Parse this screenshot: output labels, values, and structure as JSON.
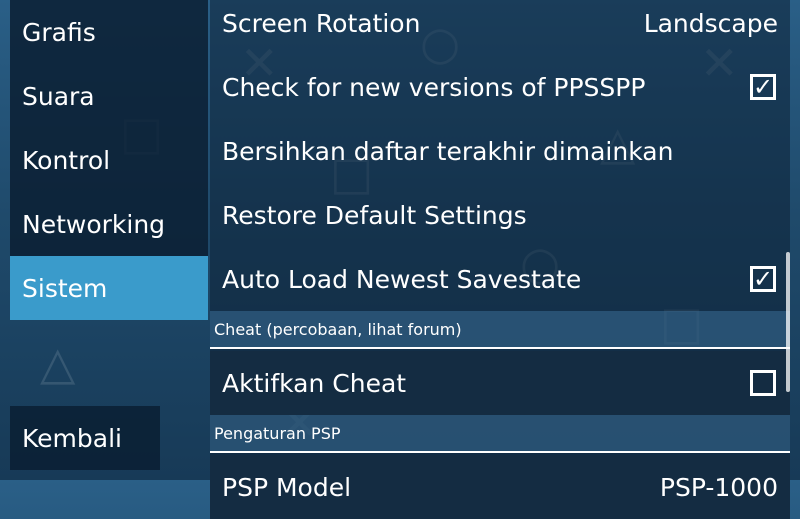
{
  "sidebar": {
    "tabs": [
      {
        "label": "Grafis"
      },
      {
        "label": "Suara"
      },
      {
        "label": "Kontrol"
      },
      {
        "label": "Networking"
      },
      {
        "label": "Sistem",
        "active": true
      }
    ],
    "back_label": "Kembali"
  },
  "settings": {
    "screen_rotation": {
      "label": "Screen Rotation",
      "value": "Landscape"
    },
    "check_versions": {
      "label": "Check for new versions of PPSSPP",
      "checked": true,
      "mark": "✓"
    },
    "clear_recent": {
      "label": "Bersihkan daftar terakhir dimainkan"
    },
    "restore_defaults": {
      "label": "Restore Default Settings"
    },
    "auto_load": {
      "label": "Auto Load Newest Savestate",
      "checked": true,
      "mark": "✓"
    },
    "cheat_header": "Cheat (percobaan, lihat forum)",
    "enable_cheat": {
      "label": "Aktifkan Cheat",
      "checked": false,
      "mark": ""
    },
    "psp_header": "Pengaturan PSP",
    "psp_model": {
      "label": "PSP Model",
      "value": "PSP-1000"
    }
  },
  "colors": {
    "active_tab": "#3a9bcb",
    "background_top": "#2a5f87",
    "background_bottom": "#173a57"
  }
}
